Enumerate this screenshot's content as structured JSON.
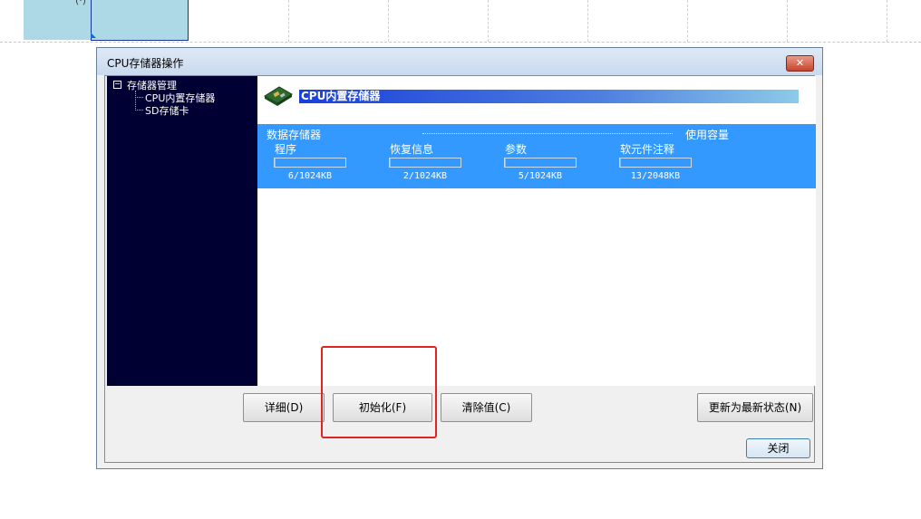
{
  "background": {
    "cell_text": "(·)"
  },
  "dialog": {
    "title": "CPU存储器操作",
    "close_glyph": "✕",
    "tree": {
      "toggle_glyph": "−",
      "root_label": "存储器管理",
      "items": [
        {
          "label": "CPU内置存储器"
        },
        {
          "label": "SD存储卡"
        }
      ]
    },
    "content": {
      "header_title": "CPU内置存储器",
      "section_label": "数据存储器",
      "used_label": "使用容量",
      "columns": [
        {
          "label": "程序",
          "value": "6/1024KB",
          "used": 6,
          "total": 1024
        },
        {
          "label": "恢复信息",
          "value": "2/1024KB",
          "used": 2,
          "total": 1024
        },
        {
          "label": "参数",
          "value": "5/1024KB",
          "used": 5,
          "total": 1024
        },
        {
          "label": "软元件注释",
          "value": "13/2048KB",
          "used": 13,
          "total": 2048
        }
      ]
    },
    "buttons": {
      "detail": "详细(D)",
      "initialize": "初始化(F)",
      "clear": "清除值(C)",
      "refresh": "更新为最新状态(N)",
      "close": "关闭"
    }
  },
  "colors": {
    "tree_bg": "#000033",
    "memory_panel": "#3399ff",
    "highlight": "#e52222"
  }
}
